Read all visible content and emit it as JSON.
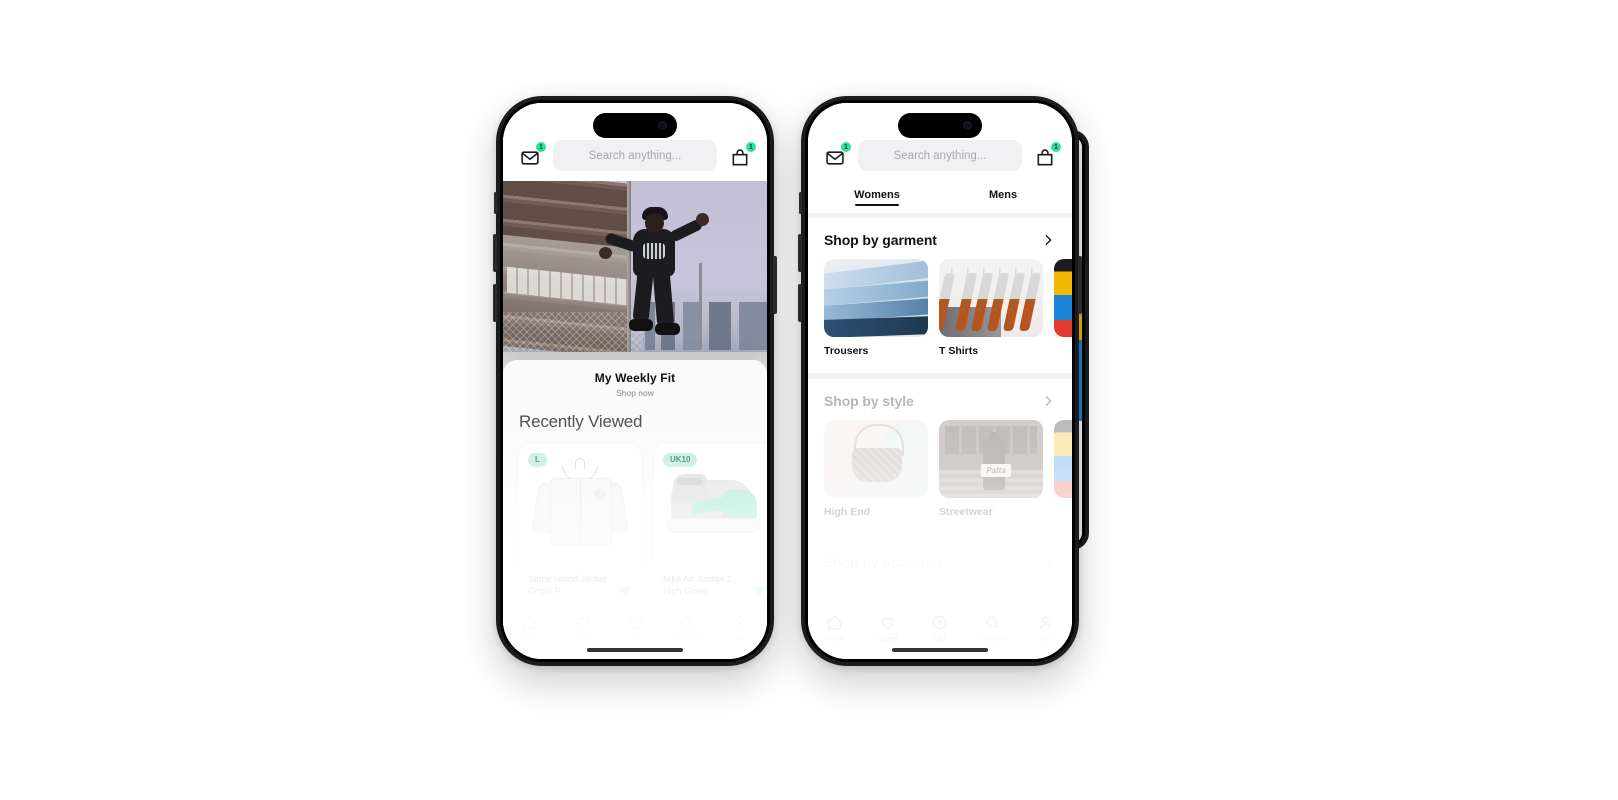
{
  "app": {
    "search": {
      "placeholder": "Search anything...",
      "icon": "search-input"
    },
    "mail": {
      "icon": "mail-icon",
      "badge": "1"
    },
    "bag": {
      "icon": "shopping-bag-icon",
      "badge": "1"
    }
  },
  "phone1": {
    "hero": {
      "alt": "skater-hero-image"
    },
    "weekly": {
      "title": "My Weekly Fit",
      "cta": "Shop now"
    },
    "recently_viewed": {
      "title": "Recently Viewed",
      "items": [
        {
          "size": "L",
          "name": "Stone Island Jacket Grigio P",
          "art": "jacket",
          "saved": true
        },
        {
          "size": "UK10",
          "name": "Nike Air Jordan 1 High Green",
          "art": "sneaker",
          "saved": true
        }
      ]
    },
    "nav": {
      "active": "Home",
      "items": [
        {
          "label": "Home",
          "icon": "home-icon"
        },
        {
          "label": "Saved",
          "icon": "heart-icon"
        },
        {
          "label": "List",
          "icon": "plus-circle-icon"
        },
        {
          "label": "Discover",
          "icon": "search-icon"
        },
        {
          "label": "Me",
          "icon": "person-icon"
        }
      ]
    }
  },
  "phone2": {
    "tabs": [
      {
        "label": "Womens",
        "active": true
      },
      {
        "label": "Mens",
        "active": false
      }
    ],
    "sections": [
      {
        "title": "Shop by garment",
        "chevron": "chevron-right-icon",
        "tiles": [
          {
            "label": "Trousers",
            "art": "jeans"
          },
          {
            "label": "T Shirts",
            "art": "hangers"
          },
          {
            "label": "",
            "art": "rainbow"
          }
        ]
      },
      {
        "title": "Shop by style",
        "chevron": "chevron-right-icon",
        "tiles": [
          {
            "label": "High End",
            "art": "bag"
          },
          {
            "label": "Streetwear",
            "art": "street"
          },
          {
            "label": "",
            "art": "rainbow"
          }
        ]
      },
      {
        "title": "Shop by occasion",
        "chevron": "chevron-right-icon",
        "tiles": []
      }
    ],
    "nav": {
      "active": "Discover",
      "items": [
        {
          "label": "Home",
          "icon": "home-icon"
        },
        {
          "label": "Saved",
          "icon": "heart-icon"
        },
        {
          "label": "List",
          "icon": "plus-circle-icon"
        },
        {
          "label": "Discover",
          "icon": "search-icon"
        },
        {
          "label": "Me",
          "icon": "person-icon"
        }
      ]
    }
  },
  "colors": {
    "accent_mint": "#2de29b",
    "pill_mint": "#b7ecd6",
    "text_dark": "#111111",
    "muted": "#8b8b90"
  }
}
